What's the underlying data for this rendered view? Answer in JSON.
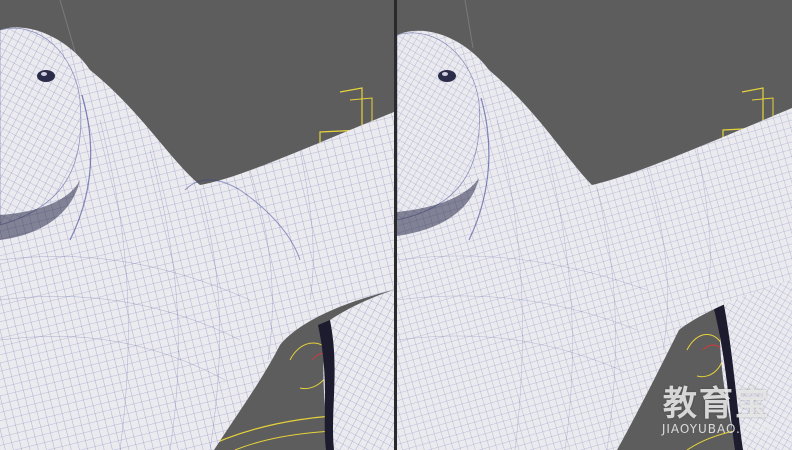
{
  "colors": {
    "viewport_bg": "#5d5d5d",
    "mesh_fill": "#eaeaef",
    "wire": "#3a3f8f",
    "shadow": "#1c1c2e",
    "curve_yellow": "#e6d23a",
    "curve_red": "#d23a3a"
  },
  "viewports": [
    {
      "name": "viewport-left",
      "shading": "wireframe-on-shaded",
      "mesh": "before-retopology"
    },
    {
      "name": "viewport-right",
      "shading": "wireframe-on-shaded",
      "mesh": "after-retopology"
    }
  ],
  "watermark": {
    "main_text": "教育宝",
    "sub_text": "JIAOYUBAO.COM"
  }
}
